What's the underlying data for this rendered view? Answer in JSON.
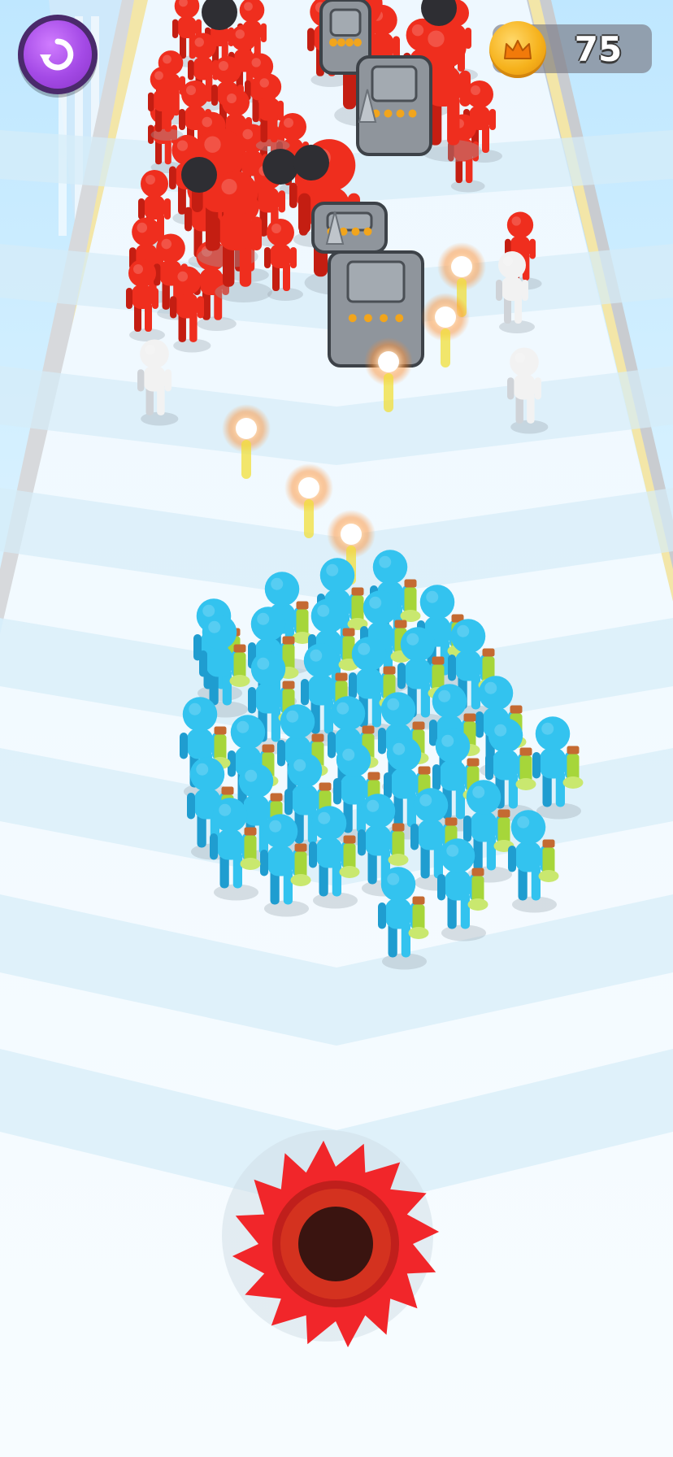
{
  "hud": {
    "restart_icon": "restart-icon",
    "coin_icon": "crown-coin-icon",
    "coin_count": "75"
  },
  "colors": {
    "player_crowd": "#33c3ef",
    "enemy_crowd": "#ef2e1e",
    "neutral": "#f2f2f2",
    "saw_blade": "#f1262a",
    "shield": "#8f959c",
    "projectile_glow": "#ff8a2a"
  },
  "scene": {
    "player_units": 38,
    "saw_blade_icon": "spinning-saw-icon"
  }
}
